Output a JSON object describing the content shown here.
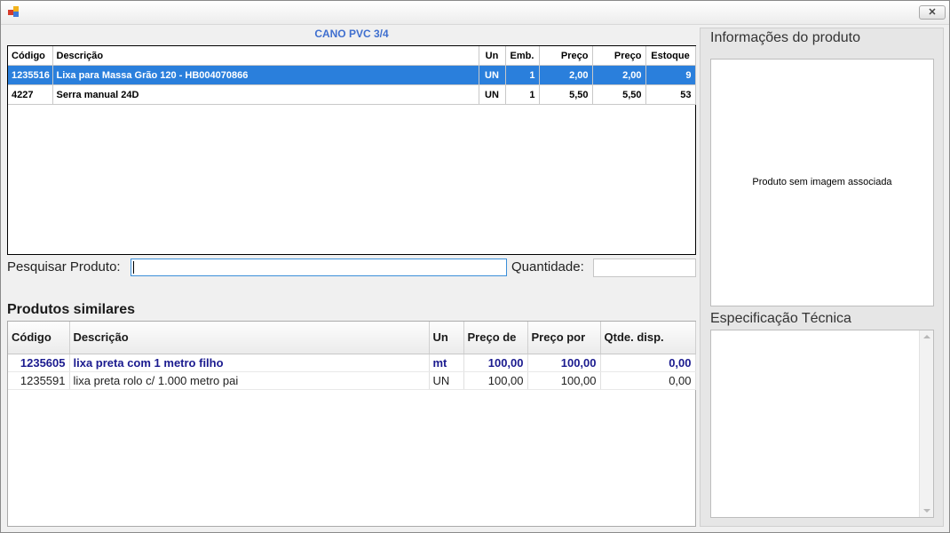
{
  "window": {
    "close_label": "✕"
  },
  "product_title": "CANO PVC 3/4",
  "results": {
    "columns": [
      "Código",
      "Descrição",
      "Un",
      "Emb.",
      "Preço",
      "Preço",
      "Estoque"
    ],
    "rows": [
      {
        "codigo": "1235516",
        "descricao": "Lixa para Massa Grão 120 - HB004070866",
        "un": "UN",
        "emb": "1",
        "preco1": "2,00",
        "preco2": "2,00",
        "estoque": "9",
        "selected": true
      },
      {
        "codigo": "4227",
        "descricao": "Serra manual 24D",
        "un": "UN",
        "emb": "1",
        "preco1": "5,50",
        "preco2": "5,50",
        "estoque": "53",
        "selected": false
      }
    ]
  },
  "search": {
    "label": "Pesquisar Produto:",
    "value": "",
    "qty_label": "Quantidade:",
    "qty_value": ""
  },
  "similar": {
    "title": "Produtos similares",
    "columns": [
      "Código",
      "Descrição",
      "Un",
      "Preço de",
      "Preço por",
      "Qtde. disp."
    ],
    "rows": [
      {
        "codigo": "1235605",
        "descricao": "lixa preta com 1 metro filho",
        "un": "mt",
        "preco_de": "100,00",
        "preco_por": "100,00",
        "qtde": "0,00",
        "bold": true
      },
      {
        "codigo": "1235591",
        "descricao": "lixa preta rolo c/ 1.000 metro pai",
        "un": "UN",
        "preco_de": "100,00",
        "preco_por": "100,00",
        "qtde": "0,00",
        "bold": false
      }
    ]
  },
  "info_panel": {
    "title": "Informações do produto",
    "no_image_text": "Produto sem imagem associada",
    "spec_title": "Especificação Técnica"
  }
}
